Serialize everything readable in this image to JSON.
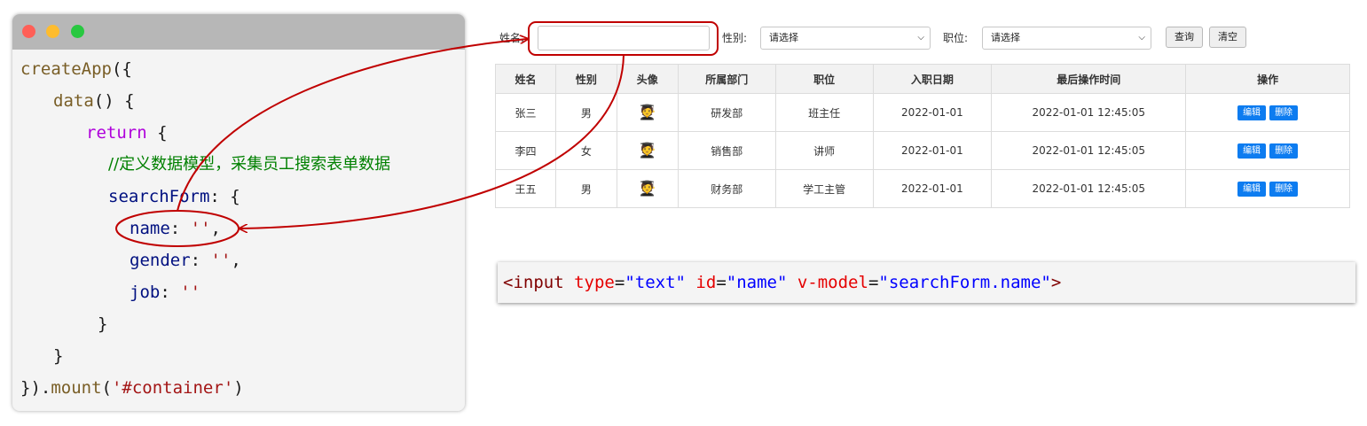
{
  "code": {
    "lines": [
      "createApp({",
      "data() {",
      "return {",
      "//定义数据模型，采集员工搜索表单数据",
      "searchForm: {",
      "name: '',",
      "gender: '',",
      "job: ''",
      "}",
      "}",
      "}).mount('#container')"
    ],
    "tokens": {
      "l0_fn": "createApp",
      "l0_p": "({",
      "l1_fn": "data",
      "l1_p": "() {",
      "l2_kw": "return",
      "l2_p": " {",
      "l3_c": "//定义数据模型，采集员工搜索表单数据",
      "l4_prop": "searchForm",
      "l4_p": ": {",
      "l5_prop": "name",
      "l5_p": ": ",
      "l5_s": "''",
      "l5_e": ",",
      "l6_prop": "gender",
      "l6_p": ": ",
      "l6_s": "''",
      "l6_e": ",",
      "l7_prop": "job",
      "l7_p": ": ",
      "l7_s": "''",
      "l8_p": "}",
      "l9_p": "}",
      "l10_p1": "}).",
      "l10_fn": "mount",
      "l10_p2": "(",
      "l10_s": "'#container'",
      "l10_p3": ")"
    }
  },
  "search": {
    "name_label": "姓名:",
    "name_value": "",
    "gender_label": "性别:",
    "gender_selected": "请选择",
    "job_label": "职位:",
    "job_selected": "请选择",
    "query_button": "查询",
    "clear_button": "清空"
  },
  "table": {
    "headers": [
      "姓名",
      "性别",
      "头像",
      "所属部门",
      "职位",
      "入职日期",
      "最后操作时间",
      "操作"
    ],
    "rows": [
      {
        "name": "张三",
        "gender": "男",
        "avatar": "🧑‍🎓",
        "dept": "研发部",
        "job": "班主任",
        "entry": "2022-01-01",
        "updated": "2022-01-01 12:45:05"
      },
      {
        "name": "李四",
        "gender": "女",
        "avatar": "🧑‍🎓",
        "dept": "销售部",
        "job": "讲师",
        "entry": "2022-01-01",
        "updated": "2022-01-01 12:45:05"
      },
      {
        "name": "王五",
        "gender": "男",
        "avatar": "🧑‍🎓",
        "dept": "财务部",
        "job": "学工主管",
        "entry": "2022-01-01",
        "updated": "2022-01-01 12:45:05"
      }
    ],
    "edit_label": "编辑",
    "delete_label": "删除"
  },
  "snippet": {
    "lt": "<",
    "tag": "input",
    "a1": "type",
    "v1": "\"text\"",
    "a2": "id",
    "v2": "\"name\"",
    "a3": "v-model",
    "v3": "\"searchForm.name\"",
    "gt": ">",
    "eq": "="
  },
  "colors": {
    "annotation": "#c00000",
    "button_primary": "#0d7cf0",
    "titlebar": "#b7b7b7"
  }
}
